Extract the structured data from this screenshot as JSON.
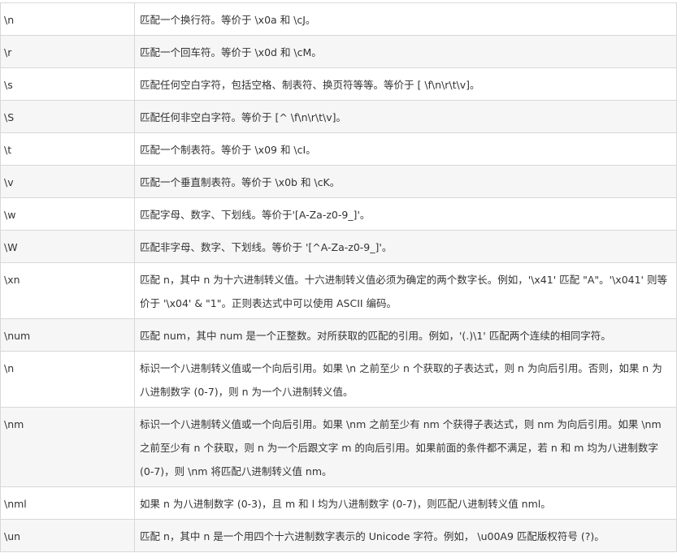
{
  "rows": [
    {
      "char": "\\n",
      "desc": "匹配一个换行符。等价于 \\x0a 和 \\cJ。"
    },
    {
      "char": "\\r",
      "desc": "匹配一个回车符。等价于 \\x0d 和 \\cM。"
    },
    {
      "char": "\\s",
      "desc": "匹配任何空白字符，包括空格、制表符、换页符等等。等价于 [ \\f\\n\\r\\t\\v]。"
    },
    {
      "char": "\\S",
      "desc": "匹配任何非空白字符。等价于 [^ \\f\\n\\r\\t\\v]。"
    },
    {
      "char": "\\t",
      "desc": "匹配一个制表符。等价于 \\x09 和 \\cI。"
    },
    {
      "char": "\\v",
      "desc": "匹配一个垂直制表符。等价于 \\x0b 和 \\cK。"
    },
    {
      "char": "\\w",
      "desc": "匹配字母、数字、下划线。等价于'[A-Za-z0-9_]'。"
    },
    {
      "char": "\\W",
      "desc": "匹配非字母、数字、下划线。等价于 '[^A-Za-z0-9_]'。"
    },
    {
      "char": "\\xn",
      "desc": "匹配 n，其中 n 为十六进制转义值。十六进制转义值必须为确定的两个数字长。例如，'\\x41' 匹配 \"A\"。'\\x041' 则等价于 '\\x04' & \"1\"。正则表达式中可以使用 ASCII 编码。"
    },
    {
      "char": "\\num",
      "desc": "匹配 num，其中 num 是一个正整数。对所获取的匹配的引用。例如，'(.)\\1' 匹配两个连续的相同字符。"
    },
    {
      "char": "\\n",
      "desc": "标识一个八进制转义值或一个向后引用。如果 \\n 之前至少 n 个获取的子表达式，则 n 为向后引用。否则，如果 n 为八进制数字 (0-7)，则 n 为一个八进制转义值。"
    },
    {
      "char": "\\nm",
      "desc": "标识一个八进制转义值或一个向后引用。如果 \\nm 之前至少有 nm 个获得子表达式，则 nm 为向后引用。如果 \\nm 之前至少有 n 个获取，则 n 为一个后跟文字 m 的向后引用。如果前面的条件都不满足，若 n 和 m 均为八进制数字 (0-7)，则 \\nm 将匹配八进制转义值 nm。"
    },
    {
      "char": "\\nml",
      "desc": "如果 n 为八进制数字 (0-3)，且 m 和 l 均为八进制数字 (0-7)，则匹配八进制转义值 nml。"
    },
    {
      "char": "\\un",
      "desc": "匹配 n，其中 n 是一个用四个十六进制数字表示的 Unicode 字符。例如， \\u00A9 匹配版权符号 (?)。"
    }
  ]
}
